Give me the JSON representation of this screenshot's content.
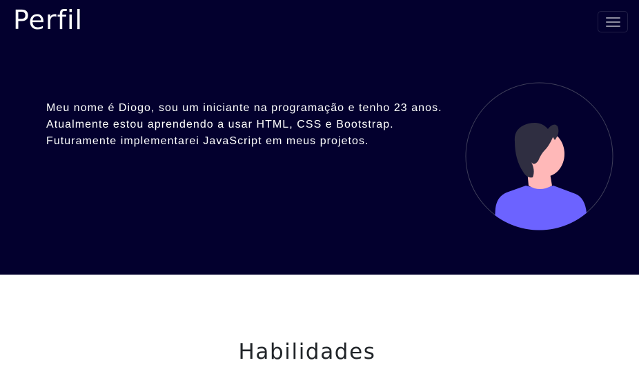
{
  "navbar": {
    "brand": "Perfil",
    "toggler_icon": "hamburger-menu-icon"
  },
  "hero": {
    "bio": "Meu nome é Diogo, sou um iniciante na programação e tenho 23 anos. Atualmente estou aprendendo a usar HTML, CSS e Bootstrap. Futuramente implementarei JavaScript em meus projetos.",
    "avatar_icon": "person-avatar-icon",
    "background_color": "#03002e"
  },
  "skills": {
    "title": "Habilidades"
  },
  "colors": {
    "avatar_shirt": "#6c63ff",
    "avatar_hair": "#2f2e41",
    "avatar_skin": "#ffb8b8"
  }
}
